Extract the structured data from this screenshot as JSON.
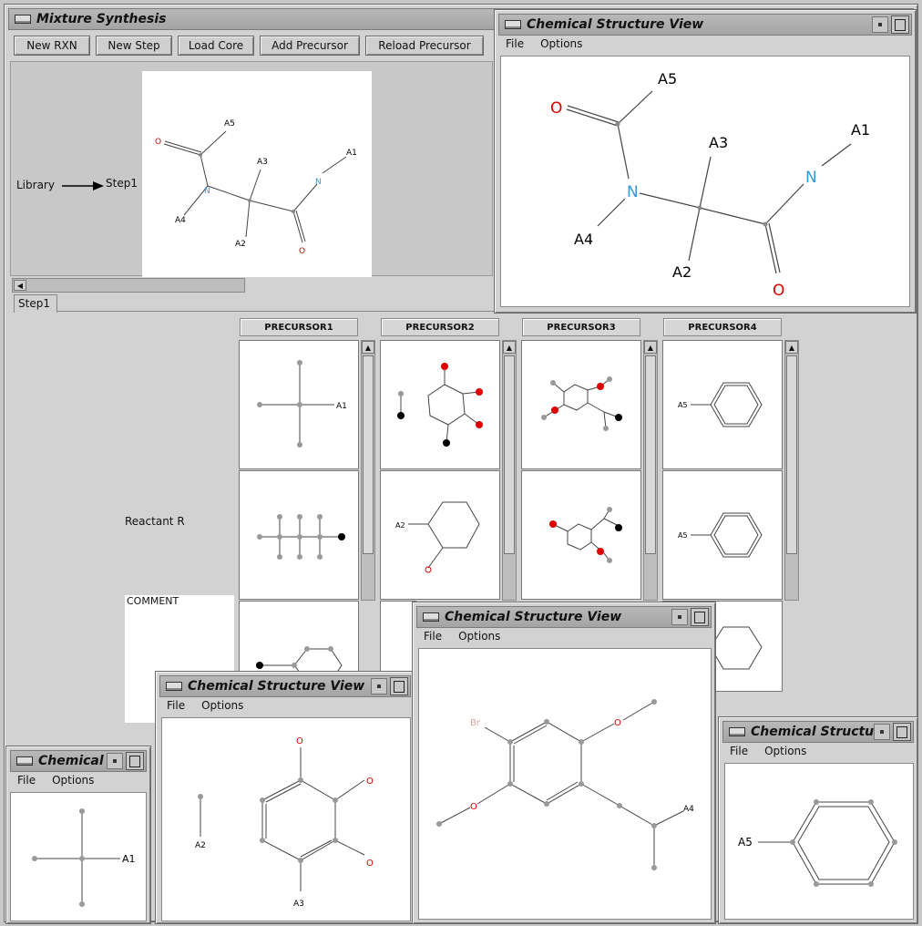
{
  "main_window": {
    "title": "Mixture Synthesis",
    "buttons": [
      "New RXN",
      "New Step",
      "Load Core",
      "Add Precursor",
      "Reload Precursor"
    ],
    "flow_from": "Library",
    "flow_to": "Step1",
    "step_tab": "Step1",
    "reactant_label": "Reactant R",
    "comment_label": "COMMENT",
    "precursor_headers": [
      "PRECURSOR1",
      "PRECURSOR2",
      "PRECURSOR3",
      "PRECURSOR4"
    ]
  },
  "structure_window_main": {
    "title": "Chemical Structure View",
    "menu": [
      "File",
      "Options"
    ]
  },
  "structure_window_a1": {
    "title": "Chemical ...",
    "menu": [
      "File",
      "Options"
    ]
  },
  "structure_window_a2": {
    "title": "Chemical Structure View",
    "menu": [
      "File",
      "Options"
    ]
  },
  "structure_window_br": {
    "title": "Chemical Structure View",
    "menu": [
      "File",
      "Options"
    ]
  },
  "structure_window_a5": {
    "title": "Chemical Structure",
    "menu": [
      "File",
      "Options"
    ]
  },
  "atom_labels": {
    "A1": "A1",
    "A2": "A2",
    "A3": "A3",
    "A4": "A4",
    "A5": "A5",
    "O": "O",
    "N": "N",
    "Br": "Br"
  },
  "colors": {
    "oxygen": "#dd0000",
    "nitrogen": "#3399dd",
    "bromine": "#e0a0a0",
    "atom": "#888888"
  }
}
